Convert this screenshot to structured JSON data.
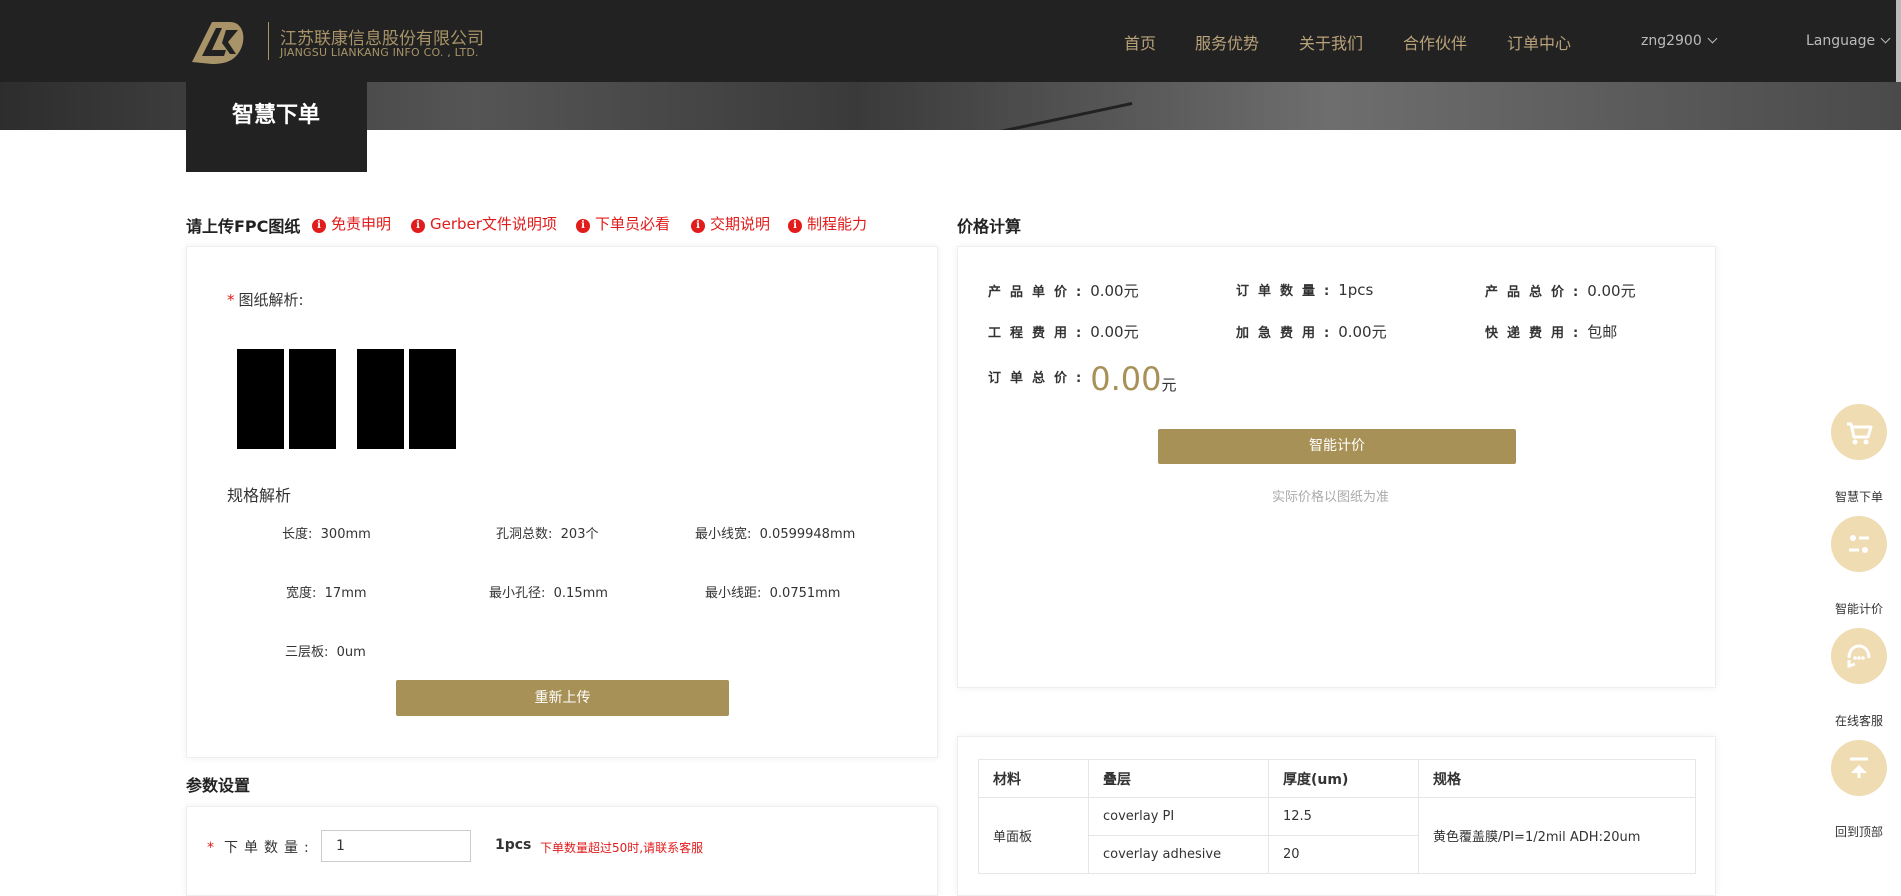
{
  "header": {
    "company_cn": "江苏联康信息股份有限公司",
    "company_en": "JIANGSU LIANKANG INFO CO. , LTD.",
    "nav": [
      "首页",
      "服务优势",
      "关于我们",
      "合作伙伴",
      "订单中心"
    ],
    "user": "zng2900",
    "language": "Language"
  },
  "page_title": "智慧下单",
  "upload": {
    "title": "请上传FPC图纸",
    "links": [
      "免责申明",
      "Gerber文件说明项",
      "下单员必看",
      "交期说明",
      "制程能力"
    ],
    "drawing_label": "图纸解析:",
    "spec_title": "规格解析",
    "specs": {
      "length_k": "长度:",
      "length_v": "300mm",
      "holes_k": "孔洞总数:",
      "holes_v": "203个",
      "minw_k": "最小线宽:",
      "minw_v": "0.0599948mm",
      "width_k": "宽度:",
      "width_v": "17mm",
      "minhole_k": "最小孔径:",
      "minhole_v": "0.15mm",
      "minspace_k": "最小线距:",
      "minspace_v": "0.0751mm",
      "layers_k": "三层板:",
      "layers_v": "0um"
    },
    "reupload": "重新上传"
  },
  "params": {
    "title": "参数设置",
    "qty_label": "下单数量:",
    "qty_value": "1",
    "qty_unit": "1pcs",
    "qty_warning": "下单数量超过50时,请联系客服"
  },
  "price": {
    "title": "价格计算",
    "unit_k": "产品单价:",
    "unit_v": "0.00元",
    "count_k": "订单数量:",
    "count_v": "1pcs",
    "total_k": "产品总价:",
    "total_v": "0.00元",
    "eng_k": "工程费用:",
    "eng_v": "0.00元",
    "rush_k": "加急费用:",
    "rush_v": "0.00元",
    "ship_k": "快递费用:",
    "ship_v": "包邮",
    "order_total_k": "订单总价:",
    "order_total_num": "0.00",
    "order_total_unit": "元",
    "calc_button": "智能计价",
    "note": "实际价格以图纸为准"
  },
  "material_table": {
    "headers": [
      "材料",
      "叠层",
      "厚度(um)",
      "规格"
    ],
    "group": "单面板",
    "rows": [
      {
        "layer": "coverlay PI",
        "thickness": "12.5"
      },
      {
        "layer": "coverlay adhesive",
        "thickness": "20"
      }
    ],
    "spec": "黄色覆盖膜/PI=1/2mil ADH:20um"
  },
  "sidebar": [
    "智慧下单",
    "智能计价",
    "在线客服",
    "回到顶部"
  ],
  "colors": {
    "gold": "#a89157",
    "dark": "#222222",
    "red": "#e21b1b",
    "side": "#efdcb2"
  }
}
